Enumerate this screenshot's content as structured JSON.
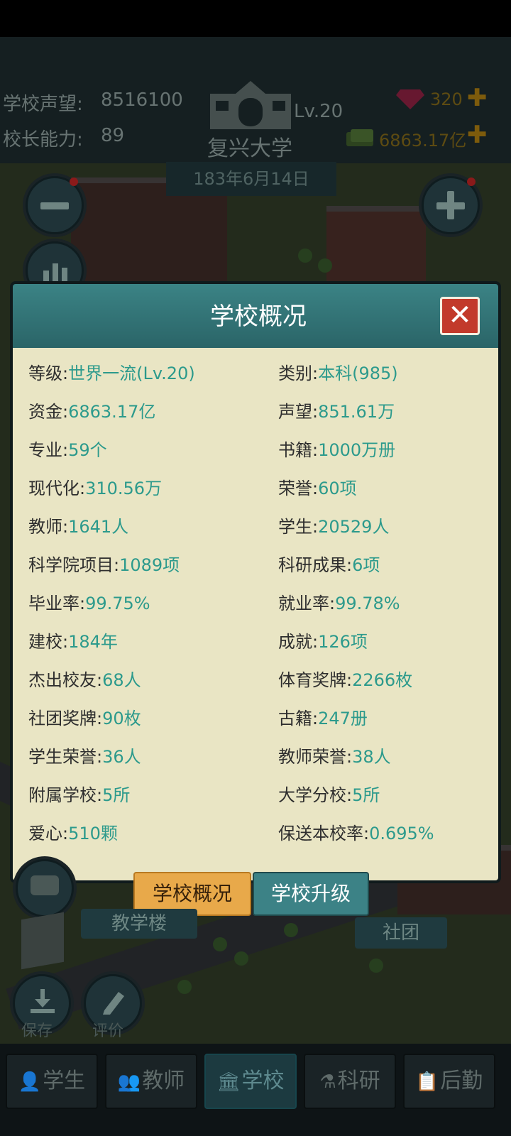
{
  "header": {
    "reputation_label": "学校声望:",
    "reputation_value": "8516100",
    "principal_label": "校长能力:",
    "principal_value": "89",
    "school_name": "复兴大学",
    "level": "Lv.20",
    "gems": "320",
    "money": "6863.17亿",
    "date": "183年6月14日"
  },
  "dialog": {
    "title": "学校概况",
    "close_label": "✕",
    "left_rows": [
      {
        "label": "等级:",
        "value": "世界一流(Lv.20)"
      },
      {
        "label": "资金:",
        "value": "6863.17亿"
      },
      {
        "label": "专业:",
        "value": "59个"
      },
      {
        "label": "现代化:",
        "value": "310.56万"
      },
      {
        "label": "教师:",
        "value": "1641人"
      },
      {
        "label": "科学院项目:",
        "value": "1089项"
      },
      {
        "label": "毕业率:",
        "value": "99.75%"
      },
      {
        "label": "建校:",
        "value": "184年"
      },
      {
        "label": "杰出校友:",
        "value": "68人"
      },
      {
        "label": "社团奖牌:",
        "value": "90枚"
      },
      {
        "label": "学生荣誉:",
        "value": "36人"
      },
      {
        "label": "附属学校:",
        "value": "5所"
      },
      {
        "label": "爱心:",
        "value": "510颗"
      }
    ],
    "right_rows": [
      {
        "label": "类别:",
        "value": "本科(985)"
      },
      {
        "label": "声望:",
        "value": "851.61万"
      },
      {
        "label": "书籍:",
        "value": "1000万册"
      },
      {
        "label": "荣誉:",
        "value": "60项"
      },
      {
        "label": "学生:",
        "value": "20529人"
      },
      {
        "label": "科研成果:",
        "value": "6项"
      },
      {
        "label": "就业率:",
        "value": "99.78%"
      },
      {
        "label": "成就:",
        "value": "126项"
      },
      {
        "label": "体育奖牌:",
        "value": "2266枚"
      },
      {
        "label": "古籍:",
        "value": "247册"
      },
      {
        "label": "教师荣誉:",
        "value": "38人"
      },
      {
        "label": "大学分校:",
        "value": "5所"
      },
      {
        "label": "保送本校率:",
        "value": "0.695%"
      }
    ]
  },
  "tabs": {
    "overview": "学校概况",
    "upgrade": "学校升级"
  },
  "map_labels": {
    "teaching_building": "教学楼",
    "club": "社团",
    "save": "保存",
    "review": "评价"
  },
  "nav": {
    "items": [
      {
        "label": "学生"
      },
      {
        "label": "教师"
      },
      {
        "label": "学校"
      },
      {
        "label": "科研"
      },
      {
        "label": "后勤"
      }
    ]
  },
  "colors": {
    "teal_accent": "#2c9a8c",
    "panel_bg": "#e9e5c4",
    "header_teal": "#3b8385",
    "active_tab": "#e8a94a"
  }
}
